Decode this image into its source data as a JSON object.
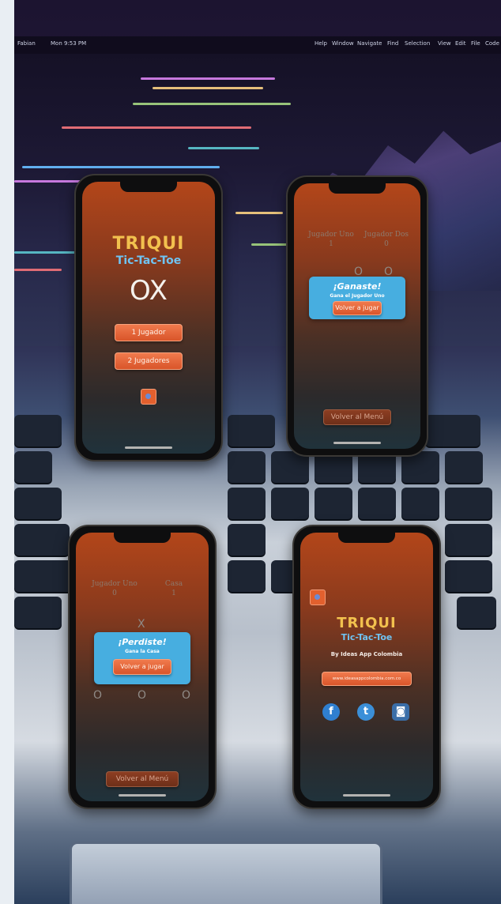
{
  "background": {
    "menubar": [
      "Fabian",
      "Mon 9:53 PM",
      "Help",
      "Window",
      "Navigate",
      "Find",
      "Selection",
      "View",
      "Edit",
      "File",
      "Code"
    ]
  },
  "phone_menu": {
    "title": "TRIQUI",
    "subtitle": "Tic-Tac-Toe",
    "logo": "OX",
    "one_player_button": "1 Jugador",
    "two_player_button": "2 Jugadores",
    "settings_icon": "gear-icon"
  },
  "phone_win": {
    "player_one_label": "Jugador Uno",
    "player_one_score": "1",
    "player_two_label": "Jugador Dos",
    "player_two_score": "0",
    "board_marks": [
      "O",
      "O"
    ],
    "popup_title": "¡Ganaste!",
    "popup_subtitle": "Gana el Jugador Uno",
    "replay_button": "Volver a jugar",
    "menu_button": "Volver al Menú"
  },
  "phone_lose": {
    "player_one_label": "Jugador Uno",
    "player_one_score": "0",
    "player_two_label": "Casa",
    "player_two_score": "1",
    "board_top_mark": "X",
    "board_bottom_marks": [
      "O",
      "O",
      "O"
    ],
    "popup_title": "¡Perdiste!",
    "popup_subtitle": "Gana la Casa",
    "replay_button": "Volver a jugar",
    "menu_button": "Volver al Menú"
  },
  "phone_about": {
    "title": "TRIQUI",
    "subtitle": "Tic-Tac-Toe",
    "credit": "By Ideas App Colombia",
    "website_button": "www.ideasappcolombia.com.co",
    "social": [
      {
        "name": "facebook-icon",
        "glyph": "f"
      },
      {
        "name": "twitter-icon",
        "glyph": "t"
      },
      {
        "name": "instagram-icon",
        "glyph": "◙"
      }
    ]
  },
  "colors": {
    "title_gold": "#f2c14e",
    "subtitle_blue": "#6fc3f2",
    "button_orange": "#e8643a",
    "popup_blue": "#47aee0"
  }
}
